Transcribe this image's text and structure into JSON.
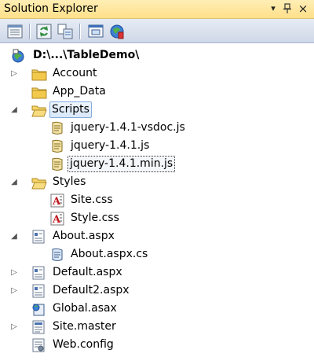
{
  "window": {
    "title": "Solution Explorer",
    "pin_glyph": "▾",
    "pin_icon": "pin-icon",
    "close_glyph": "×"
  },
  "toolbar": {
    "buttons": [
      "properties-icon",
      "refresh-icon",
      "nest-files-icon",
      "view-designer-icon",
      "aspnet-config-icon"
    ]
  },
  "tree": {
    "project": "D:\\...\\TableDemo\\",
    "items": [
      {
        "label": "Account",
        "icon": "folder-icon",
        "expander": "collapsed"
      },
      {
        "label": "App_Data",
        "icon": "folder-icon",
        "expander": "none"
      },
      {
        "label": "Scripts",
        "icon": "open-folder-icon",
        "expander": "expanded"
      },
      {
        "label": "jquery-1.4.1-vsdoc.js",
        "icon": "js-file-icon",
        "expander": "none"
      },
      {
        "label": "jquery-1.4.1.js",
        "icon": "js-file-icon",
        "expander": "none"
      },
      {
        "label": "jquery-1.4.1.min.js",
        "icon": "js-file-icon",
        "expander": "none"
      },
      {
        "label": "Styles",
        "icon": "open-folder-icon",
        "expander": "expanded"
      },
      {
        "label": "Site.css",
        "icon": "css-file-icon",
        "expander": "none"
      },
      {
        "label": "Style.css",
        "icon": "css-file-icon",
        "expander": "none"
      },
      {
        "label": "About.aspx",
        "icon": "aspx-file-icon",
        "expander": "expanded"
      },
      {
        "label": "About.aspx.cs",
        "icon": "cs-file-icon",
        "expander": "none"
      },
      {
        "label": "Default.aspx",
        "icon": "aspx-file-icon",
        "expander": "collapsed"
      },
      {
        "label": "Default2.aspx",
        "icon": "aspx-file-icon",
        "expander": "collapsed"
      },
      {
        "label": "Global.asax",
        "icon": "asax-file-icon",
        "expander": "none"
      },
      {
        "label": "Site.master",
        "icon": "master-file-icon",
        "expander": "collapsed"
      },
      {
        "label": "Web.config",
        "icon": "config-file-icon",
        "expander": "none"
      }
    ]
  },
  "colors": {
    "title_bar": "#ffe08a",
    "toolbar": "#cfd8e8",
    "selection_border": "#84acdd",
    "folder": "#f2c94c"
  }
}
